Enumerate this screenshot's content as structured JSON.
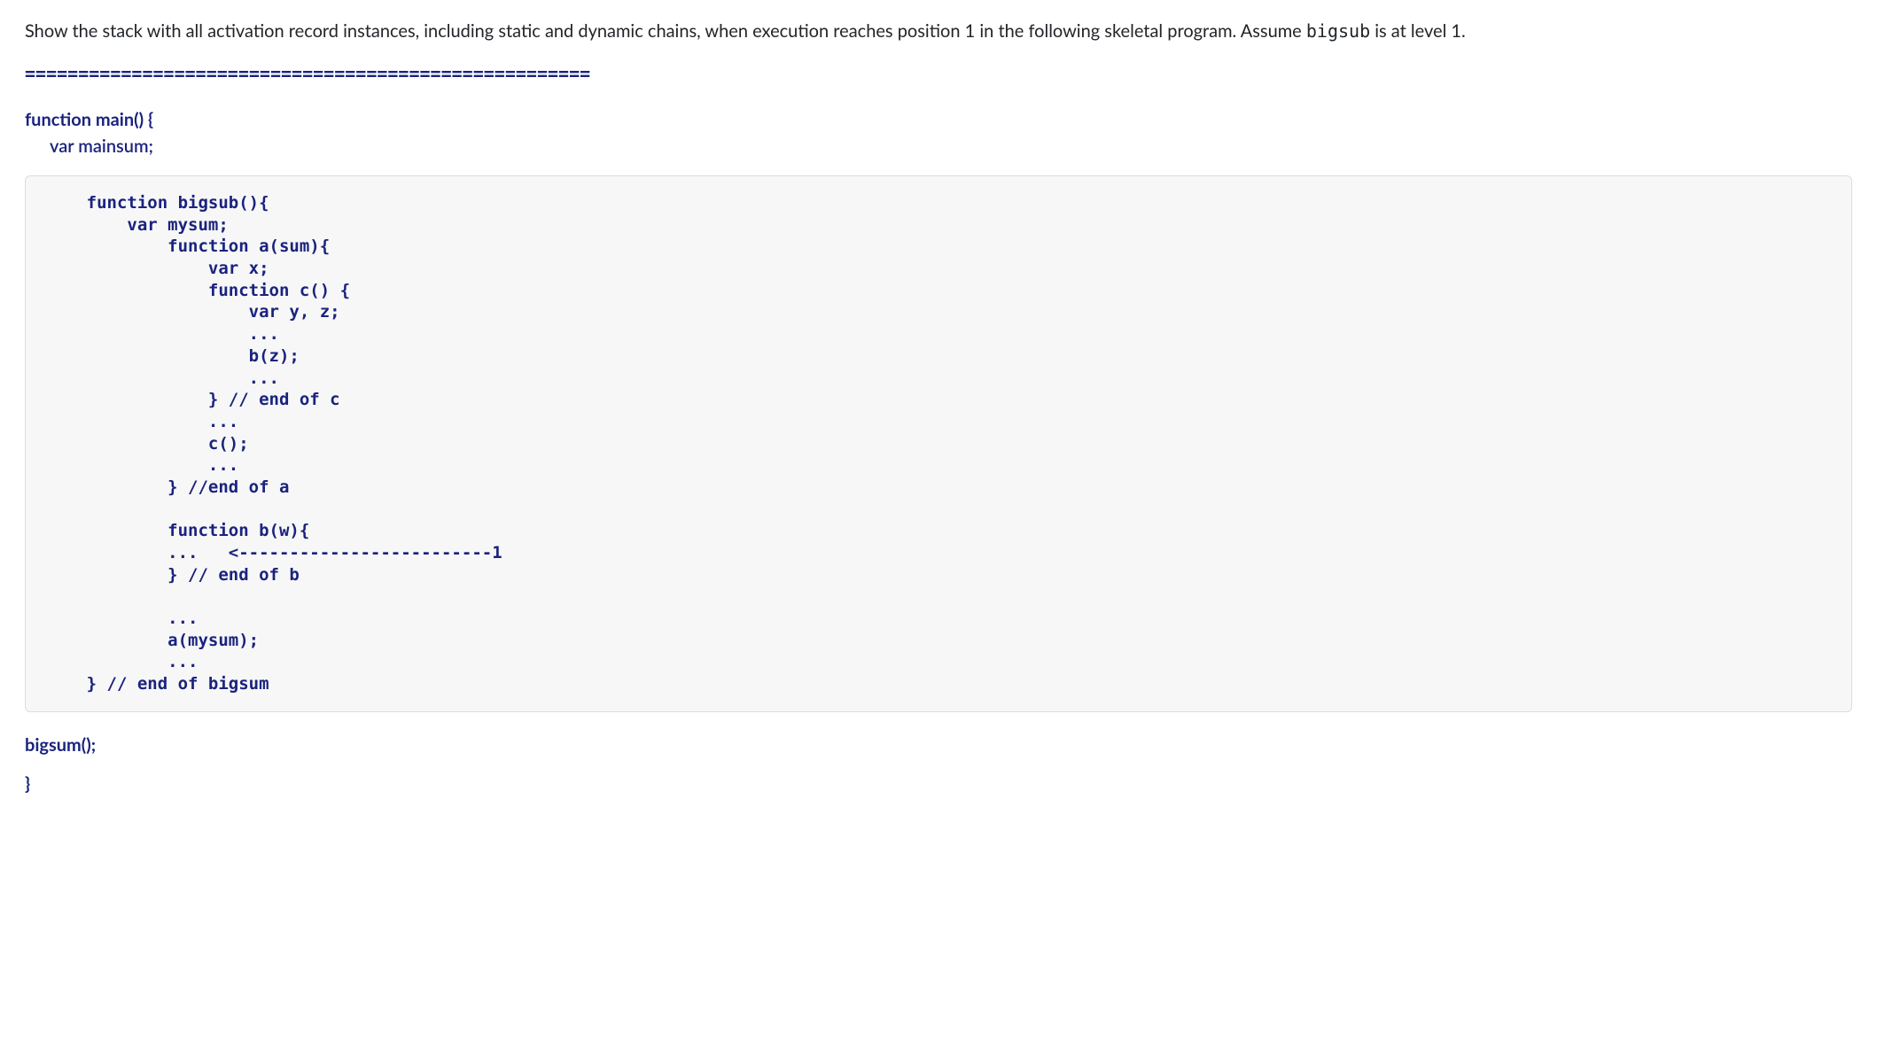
{
  "question": {
    "part1": "Show the stack with all activation record instances, including static and dynamic chains, when execution reaches position 1 in the following skeletal program. Assume ",
    "mono": "bigsub",
    "part2": " is at level 1."
  },
  "divider": "=====================================================",
  "main_header": "function main() {",
  "main_var": "var mainsum;",
  "code": "      function bigsub(){\n          var mysum;\n              function a(sum){\n                  var x;\n                  function c() {\n                      var y, z;\n                      ...\n                      b(z);\n                      ...\n                  } // end of c\n                  ...\n                  c();\n                  ...\n              } //end of a\n\n              function b(w){\n              ...   <-------------------------1\n              } // end of b\n\n              ...\n              a(mysum);\n              ...\n      } // end of bigsum",
  "after_call": "bigsum();",
  "closing_brace": "}"
}
